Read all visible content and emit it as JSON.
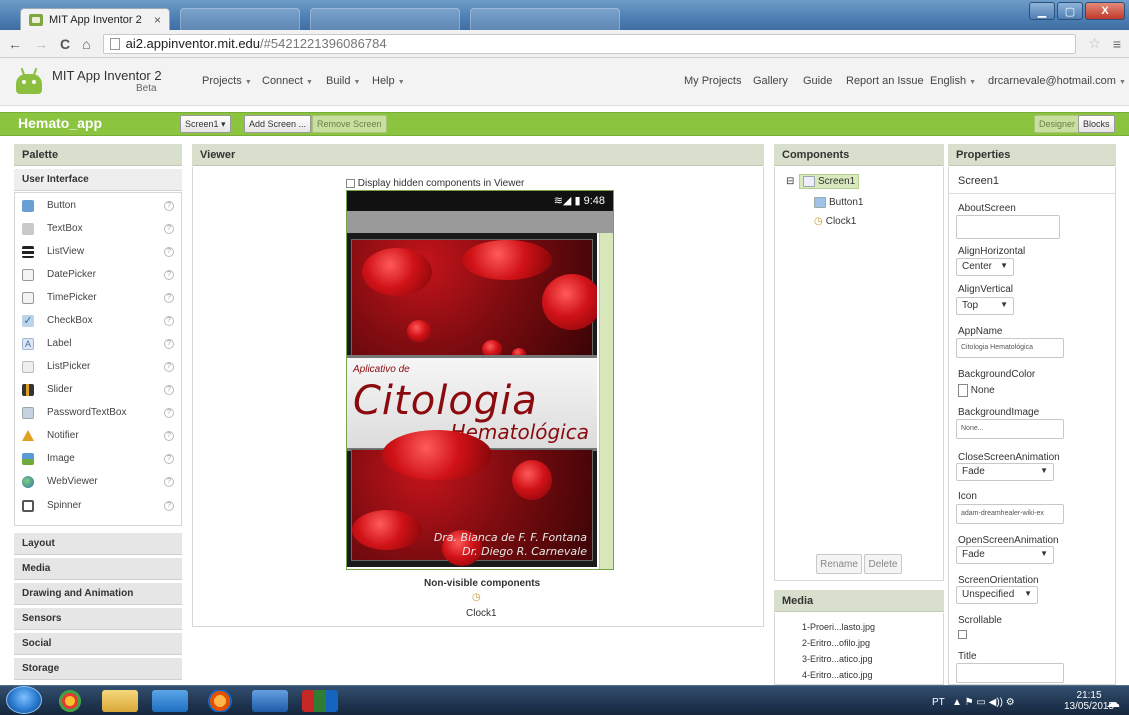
{
  "browser": {
    "tab_title": "MIT App Inventor 2",
    "tab_close": "×",
    "back": "←",
    "forward": "→",
    "reload": "C",
    "home": "⌂",
    "url_host": "ai2.appinventor.mit.edu",
    "url_path": "/#5421221396086784",
    "bookmark": "☆",
    "window_buttons": [
      "▁",
      "▢",
      "X"
    ]
  },
  "header": {
    "brand": "MIT App Inventor 2",
    "beta": "Beta",
    "menus": [
      "Projects",
      "Connect",
      "Build",
      "Help"
    ],
    "right_links": [
      "My Projects",
      "Gallery",
      "Guide",
      "Report an Issue",
      "English",
      "drcarnevale@hotmail.com"
    ]
  },
  "toolbar": {
    "project_name": "Hemato_app",
    "screen_select": "Screen1 ▾",
    "add_screen": "Add Screen ...",
    "remove_screen": "Remove Screen",
    "designer": "Designer",
    "blocks": "Blocks"
  },
  "palette": {
    "title": "Palette",
    "open_category": "User Interface",
    "items": [
      {
        "label": "Button",
        "icon": "button-icon",
        "color": "#6a9fd4"
      },
      {
        "label": "TextBox",
        "icon": "textbox-icon",
        "color": "#c9c9c9"
      },
      {
        "label": "ListView",
        "icon": "listview-icon",
        "color": "#222222"
      },
      {
        "label": "DatePicker",
        "icon": "datepicker-icon",
        "color": "#bbbbbb"
      },
      {
        "label": "TimePicker",
        "icon": "timepicker-icon",
        "color": "#bbbbbb"
      },
      {
        "label": "CheckBox",
        "icon": "checkbox-icon",
        "color": "#4a86c5"
      },
      {
        "label": "Label",
        "icon": "label-icon",
        "color": "#9fb6d6"
      },
      {
        "label": "ListPicker",
        "icon": "listpicker-icon",
        "color": "#d8d8d8"
      },
      {
        "label": "Slider",
        "icon": "slider-icon",
        "color": "#444444"
      },
      {
        "label": "PasswordTextBox",
        "icon": "password-icon",
        "color": "#c6d2e0"
      },
      {
        "label": "Notifier",
        "icon": "notifier-icon",
        "color": "#e0a020"
      },
      {
        "label": "Image",
        "icon": "image-icon",
        "color": "#5a9bd6"
      },
      {
        "label": "WebViewer",
        "icon": "webviewer-icon",
        "color": "#2e6fb0"
      },
      {
        "label": "Spinner",
        "icon": "spinner-icon",
        "color": "#555555"
      }
    ],
    "help_glyph": "?",
    "categories": [
      "Layout",
      "Media",
      "Drawing and Animation",
      "Sensors",
      "Social",
      "Storage"
    ]
  },
  "viewer": {
    "title": "Viewer",
    "display_hidden": "Display hidden components in Viewer",
    "status_time": "9:48",
    "status_icons": "≋◢ ▮",
    "image_small": "Aplicativo de",
    "image_big": "Citologia",
    "image_sub": "Hematológica",
    "credit_1": "Dra. Bianca de F. F. Fontana",
    "credit_2": "Dr. Diego R. Carnevale",
    "non_visible_title": "Non-visible components",
    "non_visible_item": "Clock1"
  },
  "components": {
    "title": "Components",
    "collapse": "⊟",
    "tree": [
      "Screen1",
      "Button1",
      "Clock1"
    ],
    "rename": "Rename",
    "delete": "Delete"
  },
  "media": {
    "title": "Media",
    "files": [
      "1-Proeri...lasto.jpg",
      "2-Eritro...ofilo.jpg",
      "3-Eritro...atico.jpg",
      "4-Eritro...atico.jpg"
    ]
  },
  "properties": {
    "title": "Properties",
    "component": "Screen1",
    "about_screen": "AboutScreen",
    "align_horizontal": "AlignHorizontal",
    "align_horizontal_value": "Center",
    "align_vertical": "AlignVertical",
    "align_vertical_value": "Top",
    "app_name": "AppName",
    "app_name_value": "Citologia Hematológica",
    "background_color": "BackgroundColor",
    "background_color_value": "None",
    "background_image": "BackgroundImage",
    "background_image_value": "None...",
    "close_anim": "CloseScreenAnimation",
    "close_anim_value": "Fade",
    "icon": "Icon",
    "icon_value": "adam-dreamhealer-wiki-ex",
    "open_anim": "OpenScreenAnimation",
    "open_anim_value": "Fade",
    "orientation": "ScreenOrientation",
    "orientation_value": "Unspecified",
    "scrollable": "Scrollable",
    "title_prop": "Title"
  },
  "taskbar": {
    "lang": "PT",
    "time": "21:15",
    "date": "13/05/2015"
  }
}
